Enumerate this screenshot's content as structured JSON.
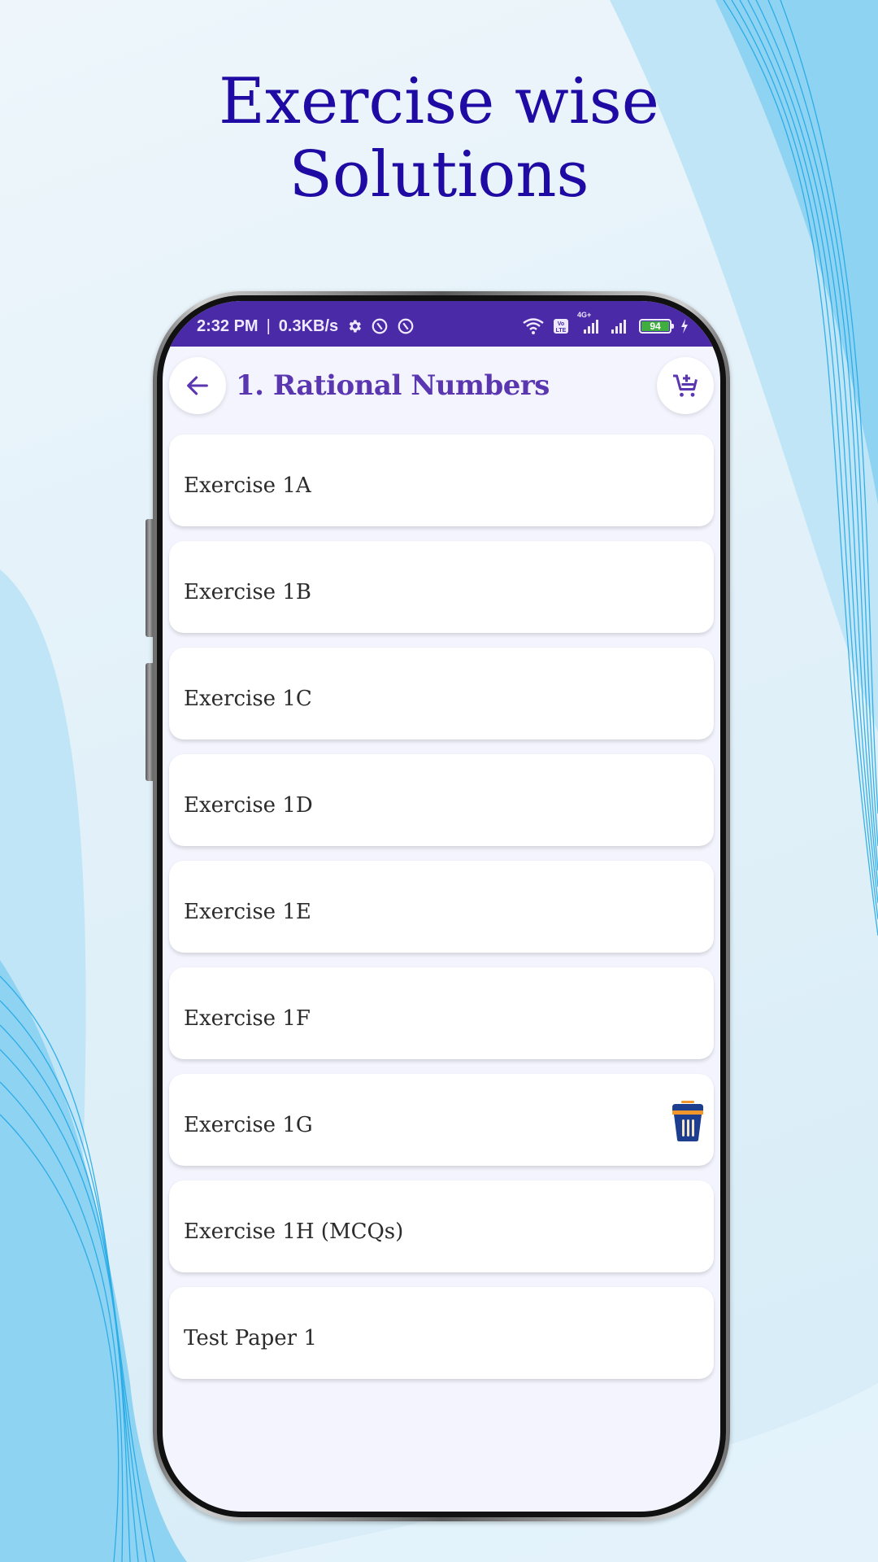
{
  "headline": {
    "line1": "Exercise wise",
    "line2": "Solutions"
  },
  "status_bar": {
    "time": "2:32 PM",
    "separator": "|",
    "net_speed": "0.3KB/s",
    "left_icons": [
      "gear-icon",
      "app-notification-icon",
      "app-notification-icon"
    ],
    "right_icons": [
      "wifi-icon",
      "volte-icon",
      "signal-4g-icon",
      "signal-icon",
      "battery-icon",
      "charging-icon"
    ],
    "network_label": "4G+",
    "volte_label": "Vo LTE",
    "battery_level": "94"
  },
  "app_bar": {
    "back_icon": "arrow-left-icon",
    "title": "1. Rational Numbers",
    "cart_icon": "add-to-cart-icon"
  },
  "colors": {
    "headline": "#1f0aa3",
    "status_bar": "#4a2aa6",
    "title": "#5a36b0",
    "screen_bg": "#f3f4fd",
    "battery_fill": "#3fae3f"
  },
  "items": [
    {
      "label": "Exercise 1A"
    },
    {
      "label": "Exercise 1B"
    },
    {
      "label": "Exercise 1C"
    },
    {
      "label": "Exercise 1D"
    },
    {
      "label": "Exercise 1E"
    },
    {
      "label": "Exercise 1F"
    },
    {
      "label": "Exercise 1G",
      "icon": "trash-icon"
    },
    {
      "label": "Exercise 1H (MCQs)"
    },
    {
      "label": "Test Paper 1"
    }
  ]
}
